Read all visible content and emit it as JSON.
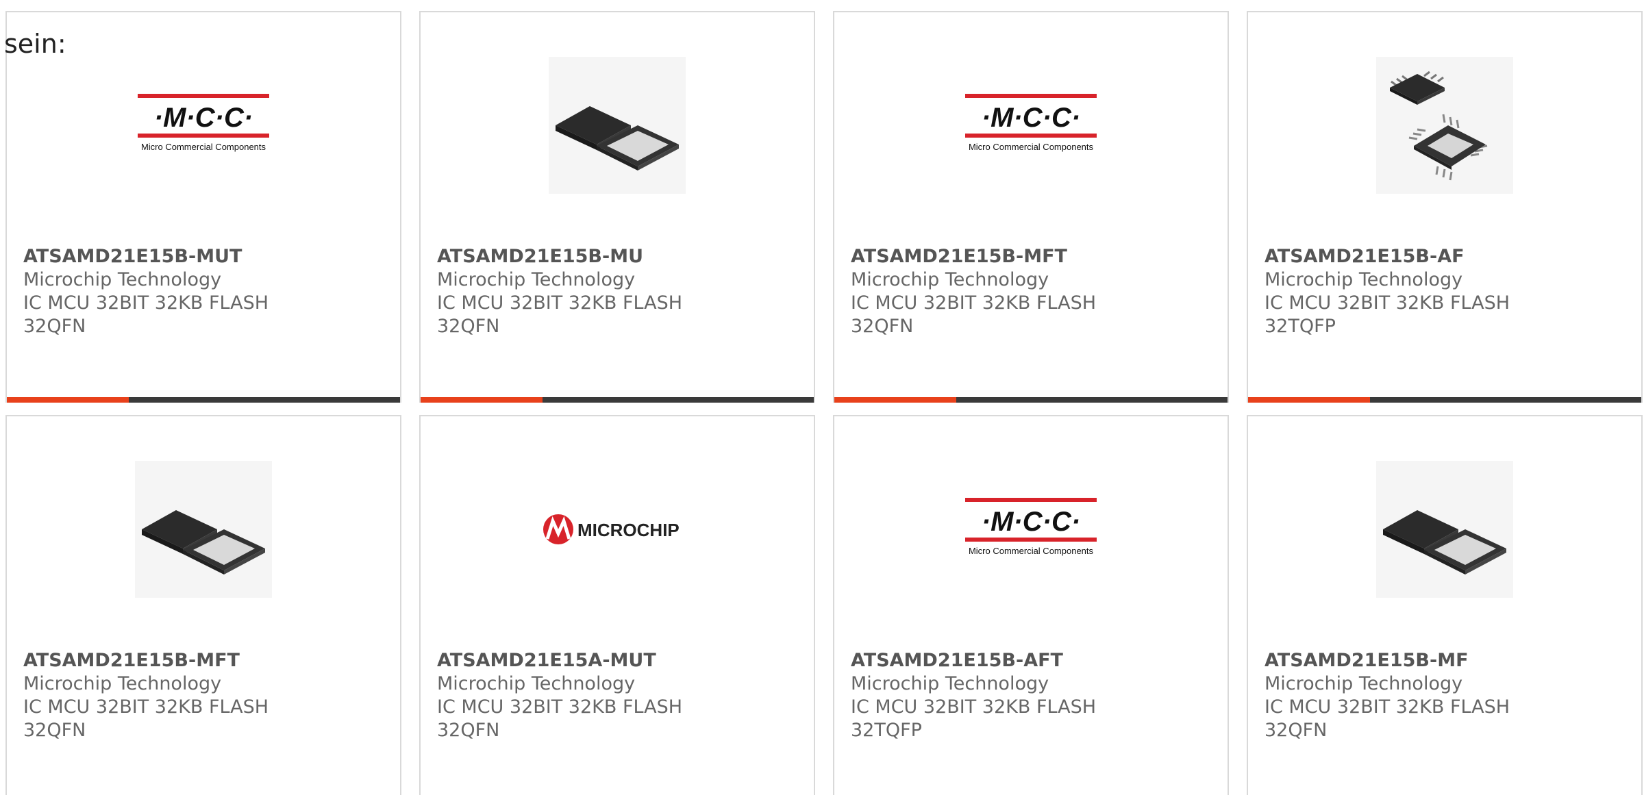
{
  "intro_text": "sein:",
  "colors": {
    "accent_bar": "#e8411b",
    "bar_base": "#3a3a3a",
    "mcc_red": "#d8232a",
    "microchip_red": "#d8232a"
  },
  "logos": {
    "mcc": {
      "mark": "·M·C·C·",
      "tagline": "Micro Commercial Components"
    },
    "microchip": {
      "wordmark": "MICROCHIP"
    }
  },
  "products": [
    {
      "part_number": "ATSAMD21E15B-MUT",
      "manufacturer": "Microchip Technology",
      "description": "IC MCU 32BIT 32KB FLASH 32QFN",
      "image": "mcc-logo",
      "accent_fraction": 0.31
    },
    {
      "part_number": "ATSAMD21E15B-MU",
      "manufacturer": "Microchip Technology",
      "description": "IC MCU 32BIT 32KB FLASH 32QFN",
      "image": "qfn-chip-photo",
      "accent_fraction": 0.31
    },
    {
      "part_number": "ATSAMD21E15B-MFT",
      "manufacturer": "Microchip Technology",
      "description": "IC MCU 32BIT 32KB FLASH 32QFN",
      "image": "mcc-logo",
      "accent_fraction": 0.31
    },
    {
      "part_number": "ATSAMD21E15B-AF",
      "manufacturer": "Microchip Technology",
      "description": "IC MCU 32BIT 32KB FLASH 32TQFP",
      "image": "tqfp-chip-photo",
      "accent_fraction": 0.31
    },
    {
      "part_number": "ATSAMD21E15B-MFT",
      "manufacturer": "Microchip Technology",
      "description": "IC MCU 32BIT 32KB FLASH 32QFN",
      "image": "qfn-chip-photo"
    },
    {
      "part_number": "ATSAMD21E15A-MUT",
      "manufacturer": "Microchip Technology",
      "description": "IC MCU 32BIT 32KB FLASH 32QFN",
      "image": "microchip-logo"
    },
    {
      "part_number": "ATSAMD21E15B-AFT",
      "manufacturer": "Microchip Technology",
      "description": "IC MCU 32BIT 32KB FLASH 32TQFP",
      "image": "mcc-logo"
    },
    {
      "part_number": "ATSAMD21E15B-MF",
      "manufacturer": "Microchip Technology",
      "description": "IC MCU 32BIT 32KB FLASH 32QFN",
      "image": "qfn-chip-photo"
    }
  ]
}
